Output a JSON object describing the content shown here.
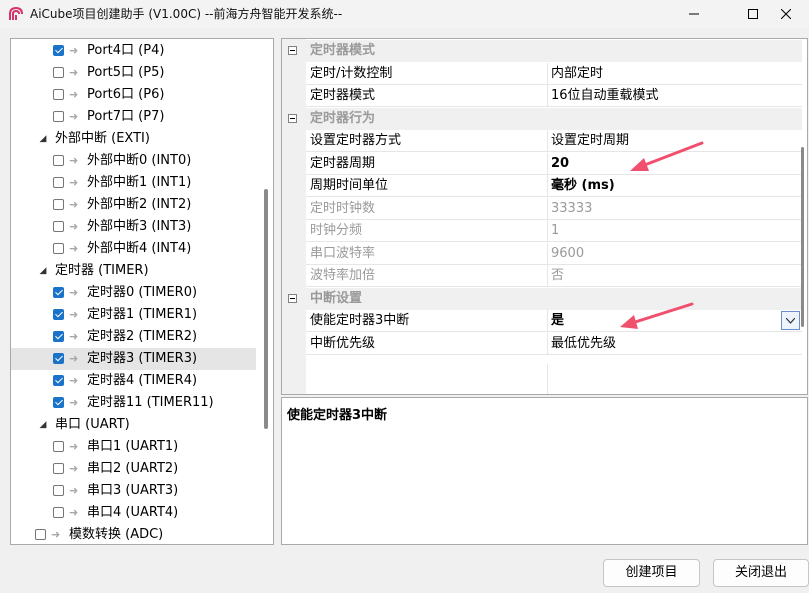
{
  "window": {
    "title": "AiCube项目创建助手 (V1.00C) --前海方舟智能开发系统--"
  },
  "tree": {
    "items": [
      {
        "label": "Port4口 (P4)",
        "checked": true
      },
      {
        "label": "Port5口 (P5)",
        "checked": false
      },
      {
        "label": "Port6口 (P6)",
        "checked": false
      },
      {
        "label": "Port7口 (P7)",
        "checked": false
      },
      {
        "label": "外部中断 (EXTI)",
        "group": true
      },
      {
        "label": "外部中断0 (INT0)",
        "checked": false
      },
      {
        "label": "外部中断1 (INT1)",
        "checked": false
      },
      {
        "label": "外部中断2 (INT2)",
        "checked": false
      },
      {
        "label": "外部中断3 (INT3)",
        "checked": false
      },
      {
        "label": "外部中断4 (INT4)",
        "checked": false
      },
      {
        "label": "定时器 (TIMER)",
        "group": true
      },
      {
        "label": "定时器0 (TIMER0)",
        "checked": true
      },
      {
        "label": "定时器1 (TIMER1)",
        "checked": true
      },
      {
        "label": "定时器2 (TIMER2)",
        "checked": true
      },
      {
        "label": "定时器3 (TIMER3)",
        "checked": true,
        "selected": true
      },
      {
        "label": "定时器4 (TIMER4)",
        "checked": true
      },
      {
        "label": "定时器11 (TIMER11)",
        "checked": true
      },
      {
        "label": "串口 (UART)",
        "group": true
      },
      {
        "label": "串口1 (UART1)",
        "checked": false
      },
      {
        "label": "串口2 (UART2)",
        "checked": false
      },
      {
        "label": "串口3 (UART3)",
        "checked": false
      },
      {
        "label": "串口4 (UART4)",
        "checked": false
      },
      {
        "label": "模数转换 (ADC)",
        "checked": false,
        "toplevel": true
      }
    ]
  },
  "grid": {
    "categories": [
      {
        "label": "定时器模式",
        "props": [
          {
            "name": "定时/计数控制",
            "value": "内部定时"
          },
          {
            "name": "定时器模式",
            "value": "16位自动重载模式"
          }
        ]
      },
      {
        "label": "定时器行为",
        "props": [
          {
            "name": "设置定时器方式",
            "value": "设置定时周期"
          },
          {
            "name": "定时器周期",
            "value": "20",
            "bold": true
          },
          {
            "name": "周期时间单位",
            "value": "毫秒 (ms)",
            "bold": true
          },
          {
            "name": "定时时钟数",
            "value": "33333",
            "disabled": true
          },
          {
            "name": "时钟分频",
            "value": "1",
            "disabled": true
          },
          {
            "name": "串口波特率",
            "value": "9600",
            "disabled": true
          },
          {
            "name": "波特率加倍",
            "value": "否",
            "disabled": true
          }
        ]
      },
      {
        "label": "中断设置",
        "props": [
          {
            "name": "使能定时器3中断",
            "value": "是",
            "bold": true,
            "dropdown": true
          },
          {
            "name": "中断优先级",
            "value": "最低优先级"
          }
        ]
      }
    ]
  },
  "description": {
    "text": "使能定时器3中断"
  },
  "buttons": {
    "create": "创建项目",
    "close": "关闭退出"
  },
  "colors": {
    "checkbox_checked": "#1a73c9",
    "annotation_arrow": "#f0506e",
    "selected_row": "#e5e5e5"
  }
}
